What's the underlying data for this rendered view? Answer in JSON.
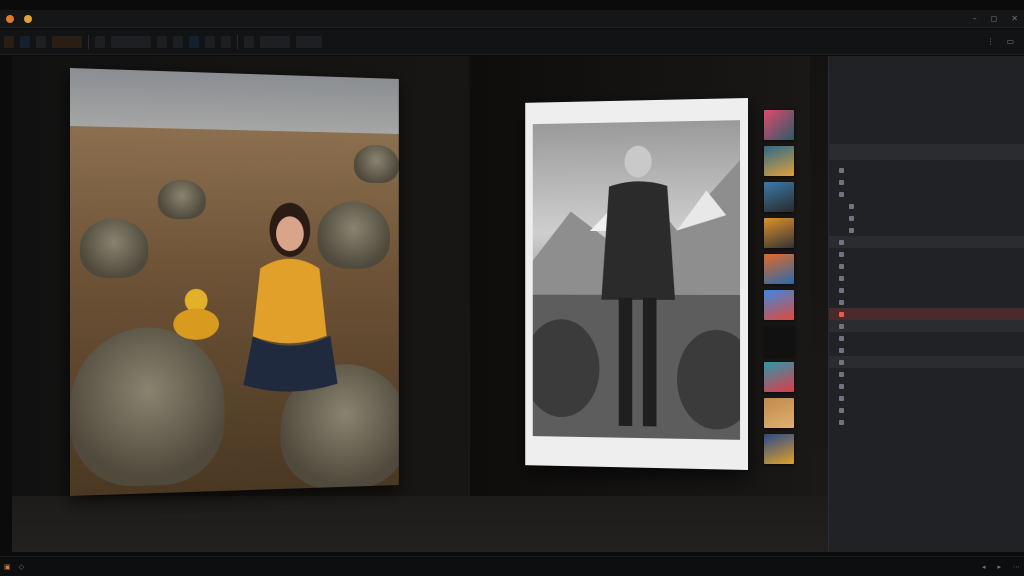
{
  "colors": {
    "accent": "#e07a2a",
    "highlight": "#4a2a2d",
    "panel": "#202225"
  },
  "panel": {
    "header": "",
    "rows": [
      "",
      "",
      "",
      "",
      "",
      "",
      "",
      "",
      "",
      "",
      "",
      "",
      "",
      "",
      "",
      "",
      "",
      "",
      "",
      "",
      "",
      ""
    ],
    "highlight_index": 12
  }
}
